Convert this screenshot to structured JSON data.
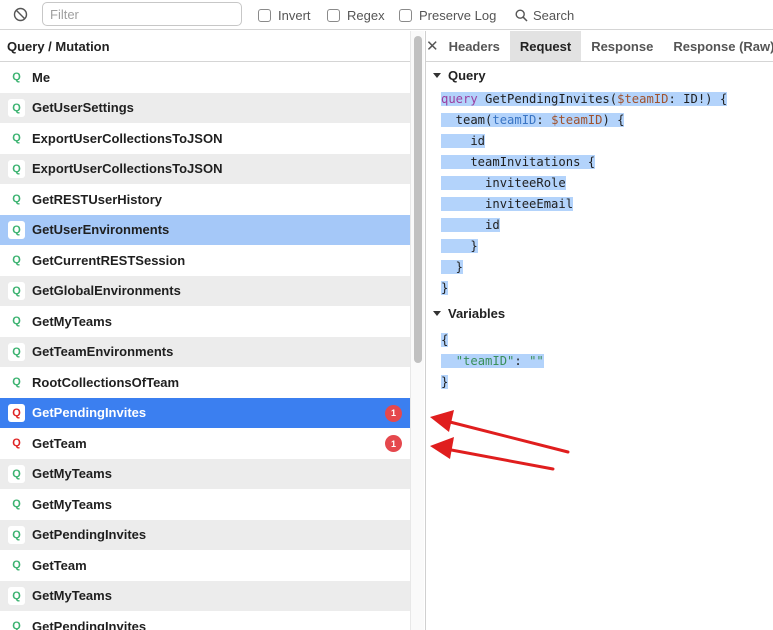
{
  "toolbar": {
    "filter_placeholder": "Filter",
    "invert_label": "Invert",
    "regex_label": "Regex",
    "preserve_log_label": "Preserve Log",
    "search_label": "Search"
  },
  "list": {
    "header": "Query / Mutation",
    "rows": [
      {
        "icon": "Q",
        "label": "Me",
        "style": "normal"
      },
      {
        "icon": "Q",
        "label": "GetUserSettings",
        "style": "alt"
      },
      {
        "icon": "Q",
        "label": "ExportUserCollectionsToJSON",
        "style": "normal"
      },
      {
        "icon": "Q",
        "label": "ExportUserCollectionsToJSON",
        "style": "alt"
      },
      {
        "icon": "Q",
        "label": "GetRESTUserHistory",
        "style": "normal"
      },
      {
        "icon": "Q",
        "label": "GetUserEnvironments",
        "style": "sel-light"
      },
      {
        "icon": "Q",
        "label": "GetCurrentRESTSession",
        "style": "normal"
      },
      {
        "icon": "Q",
        "label": "GetGlobalEnvironments",
        "style": "alt"
      },
      {
        "icon": "Q",
        "label": "GetMyTeams",
        "style": "normal"
      },
      {
        "icon": "Q",
        "label": "GetTeamEnvironments",
        "style": "alt"
      },
      {
        "icon": "Q",
        "label": "RootCollectionsOfTeam",
        "style": "normal"
      },
      {
        "icon": "Q",
        "label": "GetPendingInvites",
        "style": "sel",
        "badge": "1",
        "error": true
      },
      {
        "icon": "Q",
        "label": "GetTeam",
        "style": "normal",
        "badge": "1",
        "error": true
      },
      {
        "icon": "Q",
        "label": "GetMyTeams",
        "style": "alt"
      },
      {
        "icon": "Q",
        "label": "GetMyTeams",
        "style": "normal"
      },
      {
        "icon": "Q",
        "label": "GetPendingInvites",
        "style": "alt"
      },
      {
        "icon": "Q",
        "label": "GetTeam",
        "style": "normal"
      },
      {
        "icon": "Q",
        "label": "GetMyTeams",
        "style": "alt"
      },
      {
        "icon": "Q",
        "label": "GetPendingInvites",
        "style": "normal"
      }
    ]
  },
  "detail": {
    "close_icon": "close-icon",
    "tabs": [
      {
        "label": "Headers",
        "active": false
      },
      {
        "label": "Request",
        "active": true
      },
      {
        "label": "Response",
        "active": false
      },
      {
        "label": "Response (Raw)",
        "active": false
      }
    ],
    "query_section_label": "Query",
    "variables_section_label": "Variables",
    "query_lines": [
      [
        {
          "t": "query",
          "c": "kw"
        },
        {
          "t": " GetPendingInvites(",
          "c": ""
        },
        {
          "t": "$teamID",
          "c": "var"
        },
        {
          "t": ": ID!) {",
          "c": ""
        }
      ],
      [
        {
          "t": "  team(",
          "c": ""
        },
        {
          "t": "teamID",
          "c": "arg"
        },
        {
          "t": ": ",
          "c": ""
        },
        {
          "t": "$teamID",
          "c": "var"
        },
        {
          "t": ") {",
          "c": ""
        }
      ],
      [
        {
          "t": "    id",
          "c": ""
        }
      ],
      [
        {
          "t": "    teamInvitations {",
          "c": ""
        }
      ],
      [
        {
          "t": "      inviteeRole",
          "c": ""
        }
      ],
      [
        {
          "t": "      inviteeEmail",
          "c": ""
        }
      ],
      [
        {
          "t": "      id",
          "c": ""
        }
      ],
      [
        {
          "t": "    }",
          "c": ""
        }
      ],
      [
        {
          "t": "  }",
          "c": ""
        }
      ],
      [
        {
          "t": "}",
          "c": ""
        }
      ]
    ],
    "variables_lines": [
      [
        {
          "t": "{",
          "c": ""
        }
      ],
      [
        {
          "t": "  ",
          "c": ""
        },
        {
          "t": "\"teamID\"",
          "c": "str"
        },
        {
          "t": ": ",
          "c": ""
        },
        {
          "t": "\"\"",
          "c": "str"
        }
      ],
      [
        {
          "t": "}",
          "c": ""
        }
      ]
    ]
  },
  "colors": {
    "selected_row": "#3b7ff0",
    "selected_light_row": "#a5c8f8",
    "error_badge": "#e5484d",
    "query_icon": "#3cb371",
    "error_icon": "#e02424",
    "annotation_arrow": "#e01e1e"
  }
}
